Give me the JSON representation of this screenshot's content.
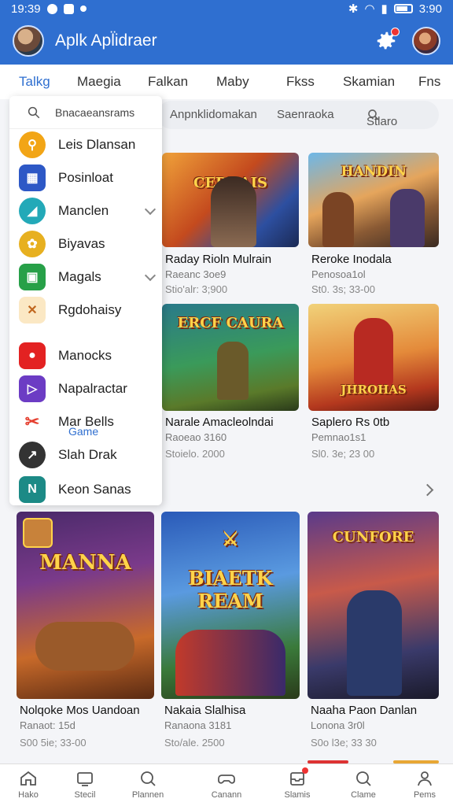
{
  "status_bar": {
    "time": "19:39",
    "right_time": "3:90"
  },
  "app_bar": {
    "title": "Aplk Apl̈idraer"
  },
  "tabs": [
    "Talkg",
    "Maegia",
    "Falkan",
    "Maby",
    "Fkss",
    "Skamian",
    "Fns"
  ],
  "filter_bar": {
    "left": "Anpnklidomakan",
    "middle": "Saenraoka",
    "right": "Stlaro"
  },
  "menu": {
    "search_placeholder": "Bnacaeansrams",
    "section_label": "Game",
    "items": [
      {
        "label": "Leis Dlansan",
        "icon": "search-circle-icon",
        "color": "#f2a516"
      },
      {
        "label": "Posinloat",
        "icon": "board-icon",
        "color": "#2d58c6"
      },
      {
        "label": "Manclen",
        "icon": "chart-icon",
        "color": "#23a9b8"
      },
      {
        "label": "Biyavas",
        "icon": "puzzle-icon",
        "color": "#e7b020"
      },
      {
        "label": "Magals",
        "icon": "image-icon",
        "color": "#27a048"
      },
      {
        "label": "Rgdohaisy",
        "icon": "swords-icon",
        "color": "#e8a735"
      },
      {
        "label": "Manocks",
        "icon": "record-icon",
        "color": "#e32222"
      },
      {
        "label": "Napalractar",
        "icon": "play-icon",
        "color": "#6c3cc4"
      },
      {
        "label": "Mar Bells",
        "icon": "scissors-icon",
        "color": "#e54030"
      },
      {
        "label": "Slah Drak",
        "icon": "arrow-icon",
        "color": "#333333"
      },
      {
        "label": "Keon Sanas",
        "icon": "nk-icon",
        "color": "#1c8a86"
      }
    ]
  },
  "cards": [
    {
      "art_title": "CEDRAIS",
      "title": "Raday Rioln Mulrain",
      "sub": "Raeanc 3oe9",
      "meta": "Stio'alr: 3;900"
    },
    {
      "art_title": "HANDIN",
      "title": "Reroke Inodala",
      "sub": "Penosoa1ol",
      "meta": "St0. 3s; 33-00"
    },
    {
      "art_title": "ERCF CAURA",
      "title": "Narale Amacleolndai",
      "sub": "Raoeao 3160",
      "meta": "Stoielo. 2000"
    },
    {
      "art_title": "JHROHAS",
      "title": "Saplero Rs 0tb",
      "sub": "Pemnao1s1",
      "meta": "Sl0. 3e; 23 00"
    },
    {
      "art_title": "MANNA",
      "title": "Nolqoke Mos Uandoan",
      "sub": "Ranaot: 15d",
      "meta": "S00 5ie; 33-00"
    },
    {
      "art_title": "BIAETK REAM",
      "title": "Nakaia Slalhisa",
      "sub": "Ranaona 3181",
      "meta": "Sto/ale. 2500"
    },
    {
      "art_title": "CUNFORE",
      "title": "Naaha Paon Danlan",
      "sub": "Lonona 3r0l",
      "meta": "S0o l3e; 33 30"
    }
  ],
  "bottom_nav": [
    {
      "label": "Hako",
      "icon": "home-icon"
    },
    {
      "label": "Stecil",
      "icon": "tv-icon"
    },
    {
      "label": "Plannen",
      "icon": "search-icon"
    },
    {
      "label": "Canann",
      "icon": "gamepad-icon"
    },
    {
      "label": "Slamis",
      "icon": "inbox-icon"
    },
    {
      "label": "Clame",
      "icon": "magnifier-icon"
    },
    {
      "label": "Pems",
      "icon": "person-icon"
    }
  ],
  "colors": {
    "primary": "#2f6fd0",
    "notification": "#e33333"
  }
}
